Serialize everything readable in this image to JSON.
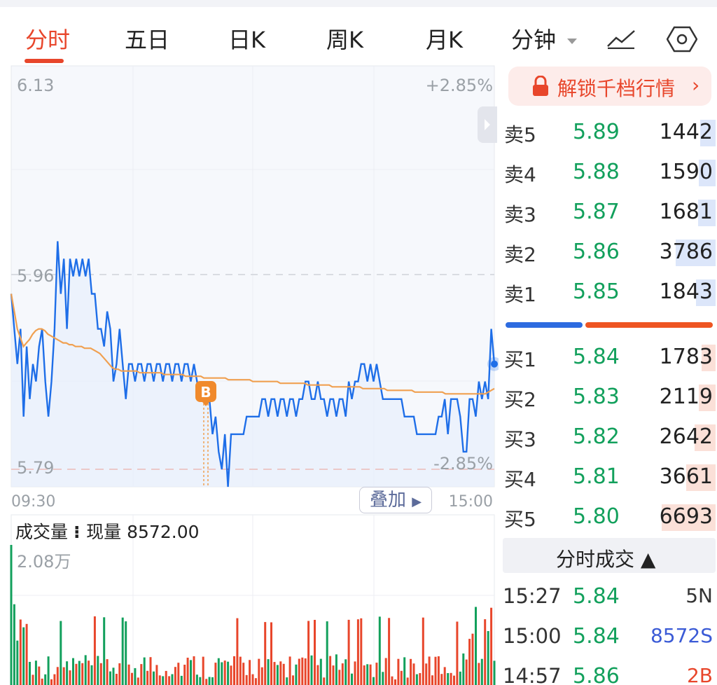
{
  "tabs": [
    "分时",
    "五日",
    "日K",
    "周K",
    "月K",
    "分钟"
  ],
  "active_tab": "分时",
  "chart": {
    "price_high": "6.13",
    "price_mid": "5.96",
    "price_low": "5.79",
    "pct_high": "+2.85%",
    "pct_low": "-2.85%",
    "time_start": "09:30",
    "time_end": "15:00",
    "overlay_label": "叠加",
    "buy_marker": "B",
    "volume_title": "成交量",
    "volume_current": "现量 8572.00",
    "volume_max": "2.08万"
  },
  "chart_data": {
    "type": "line",
    "y_range": [
      5.79,
      6.13
    ],
    "reference_price": 5.96,
    "series": [
      {
        "values": [
          5.9,
          5.88,
          5.86,
          5.88,
          5.83,
          5.87,
          5.84,
          5.86,
          5.85,
          5.87,
          5.88,
          5.85,
          5.83,
          5.85,
          5.88,
          5.93,
          5.9,
          5.92,
          5.88,
          5.92,
          5.91,
          5.92,
          5.91,
          5.92,
          5.91,
          5.92,
          5.9,
          5.9,
          5.88,
          5.88,
          5.87,
          5.89,
          5.88,
          5.85,
          5.86,
          5.88,
          5.86,
          5.84,
          5.86,
          5.86,
          5.85,
          5.86,
          5.86,
          5.85,
          5.86,
          5.86,
          5.85,
          5.86,
          5.86,
          5.85,
          5.86,
          5.86,
          5.85,
          5.86,
          5.86,
          5.85,
          5.86,
          5.86,
          5.85,
          5.86,
          5.85,
          5.84,
          5.84,
          5.85,
          5.84,
          5.82,
          5.83,
          5.81,
          5.8,
          5.82,
          5.79,
          5.82,
          5.82,
          5.82,
          5.82,
          5.82,
          5.83,
          5.83,
          5.83,
          5.83,
          5.83,
          5.84,
          5.84,
          5.83,
          5.84,
          5.84,
          5.83,
          5.84,
          5.84,
          5.83,
          5.84,
          5.84,
          5.83,
          5.84,
          5.84,
          5.85,
          5.85,
          5.84,
          5.84,
          5.85,
          5.84,
          5.84,
          5.83,
          5.84,
          5.84,
          5.83,
          5.84,
          5.84,
          5.83,
          5.85,
          5.84,
          5.85,
          5.85,
          5.86,
          5.86,
          5.85,
          5.86,
          5.85,
          5.86,
          5.85,
          5.84,
          5.84,
          5.84,
          5.84,
          5.84,
          5.84,
          5.84,
          5.83,
          5.83,
          5.83,
          5.83,
          5.82,
          5.82,
          5.82,
          5.82,
          5.82,
          5.82,
          5.82,
          5.83,
          5.83,
          5.84,
          5.82,
          5.84,
          5.84,
          5.84,
          5.83,
          5.81,
          5.81,
          5.84,
          5.84,
          5.83,
          5.85,
          5.84,
          5.85,
          5.84,
          5.88,
          5.86
        ],
        "color": "#1e6ee8"
      },
      {
        "values": [
          5.9,
          5.89,
          5.88,
          5.875,
          5.87,
          5.872,
          5.874,
          5.877,
          5.879,
          5.88,
          5.88,
          5.879,
          5.877,
          5.876,
          5.875,
          5.874,
          5.873,
          5.872,
          5.872,
          5.871,
          5.871,
          5.87,
          5.87,
          5.87,
          5.869,
          5.869,
          5.869,
          5.868,
          5.867,
          5.866,
          5.864,
          5.862,
          5.86,
          5.858,
          5.857,
          5.857,
          5.856,
          5.856,
          5.856,
          5.856,
          5.856,
          5.856,
          5.855,
          5.855,
          5.855,
          5.855,
          5.855,
          5.855,
          5.855,
          5.855,
          5.854,
          5.854,
          5.854,
          5.854,
          5.854,
          5.854,
          5.854,
          5.853,
          5.853,
          5.853,
          5.853,
          5.853,
          5.853,
          5.852,
          5.852,
          5.852,
          5.852,
          5.852,
          5.852,
          5.852,
          5.852,
          5.851,
          5.851,
          5.851,
          5.851,
          5.851,
          5.851,
          5.851,
          5.851,
          5.85,
          5.85,
          5.85,
          5.85,
          5.85,
          5.85,
          5.85,
          5.85,
          5.85,
          5.849,
          5.849,
          5.849,
          5.849,
          5.849,
          5.849,
          5.849,
          5.849,
          5.849,
          5.848,
          5.848,
          5.848,
          5.848,
          5.848,
          5.848,
          5.848,
          5.848,
          5.847,
          5.847,
          5.847,
          5.847,
          5.847,
          5.847,
          5.847,
          5.847,
          5.847,
          5.847,
          5.846,
          5.846,
          5.846,
          5.846,
          5.846,
          5.846,
          5.846,
          5.846,
          5.845,
          5.845,
          5.845,
          5.845,
          5.845,
          5.845,
          5.845,
          5.845,
          5.845,
          5.844,
          5.844,
          5.844,
          5.844,
          5.844,
          5.844,
          5.844,
          5.844,
          5.844,
          5.844,
          5.843,
          5.843,
          5.843,
          5.843,
          5.843,
          5.843,
          5.843,
          5.843,
          5.843,
          5.843,
          5.843,
          5.843,
          5.843,
          5.843,
          5.844,
          5.845,
          5.846
        ],
        "color": "#f0a050"
      }
    ]
  },
  "orderbook": {
    "unlock_label": "解锁千档行情",
    "asks": [
      {
        "label": "卖5",
        "price": "5.89",
        "qty": "1442",
        "depth": 0.22
      },
      {
        "label": "卖4",
        "price": "5.88",
        "qty": "1590",
        "depth": 0.24
      },
      {
        "label": "卖3",
        "price": "5.87",
        "qty": "1681",
        "depth": 0.25
      },
      {
        "label": "卖2",
        "price": "5.86",
        "qty": "3786",
        "depth": 0.57
      },
      {
        "label": "卖1",
        "price": "5.85",
        "qty": "1843",
        "depth": 0.28
      }
    ],
    "buy_sell_ratio": 0.38,
    "bids": [
      {
        "label": "买1",
        "price": "5.84",
        "qty": "1783",
        "depth": 0.2
      },
      {
        "label": "买2",
        "price": "5.83",
        "qty": "2119",
        "depth": 0.24
      },
      {
        "label": "买3",
        "price": "5.82",
        "qty": "2642",
        "depth": 0.3
      },
      {
        "label": "买4",
        "price": "5.81",
        "qty": "3661",
        "depth": 0.42
      },
      {
        "label": "买5",
        "price": "5.80",
        "qty": "6693",
        "depth": 0.77
      }
    ]
  },
  "trades": {
    "header": "分时成交",
    "rows": [
      {
        "time": "15:27",
        "price": "5.84",
        "vol": "5N"
      },
      {
        "time": "15:00",
        "price": "5.84",
        "vol": "8572S"
      },
      {
        "time": "14:57",
        "price": "5.86",
        "vol": "2B"
      }
    ]
  },
  "colors": {
    "accent": "#e8462b",
    "rise": "#e8462b",
    "fall": "#12a05c",
    "line": "#1e6ee8",
    "avg": "#f0a050",
    "ask_bar": "#dce6fa",
    "bid_bar": "#fbe0d8"
  }
}
